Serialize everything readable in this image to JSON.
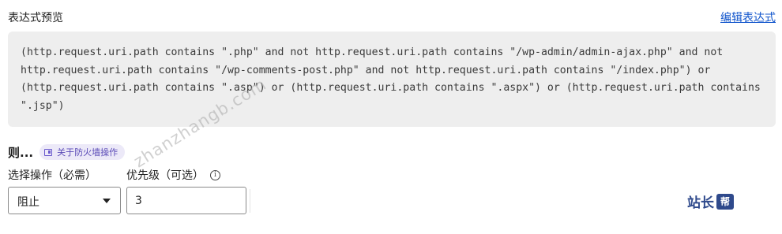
{
  "preview": {
    "title": "表达式预览",
    "edit_link": "编辑表达式",
    "expression": "(http.request.uri.path contains \".php\" and not http.request.uri.path contains \"/wp-admin/admin-ajax.php\" and not\nhttp.request.uri.path contains \"/wp-comments-post.php\" and not http.request.uri.path contains \"/index.php\") or\n(http.request.uri.path contains \".asp\") or (http.request.uri.path contains \".aspx\") or (http.request.uri.path contains\n\".jsp\")"
  },
  "then": {
    "label": "则...",
    "badge": "关于防火墙操作"
  },
  "action": {
    "label": "选择操作（必需）",
    "selected": "阻止"
  },
  "priority": {
    "label": "优先级（可选）",
    "info_glyph": "i",
    "value": "3"
  },
  "watermark": {
    "url": "zhanzhangb.com",
    "logo_text": "站长",
    "logo_mark": "帮"
  },
  "colors": {
    "link": "#1155cc",
    "badge_bg": "#ece9f8",
    "badge_text": "#5b4bb7",
    "code_bg": "#eeeeee"
  }
}
